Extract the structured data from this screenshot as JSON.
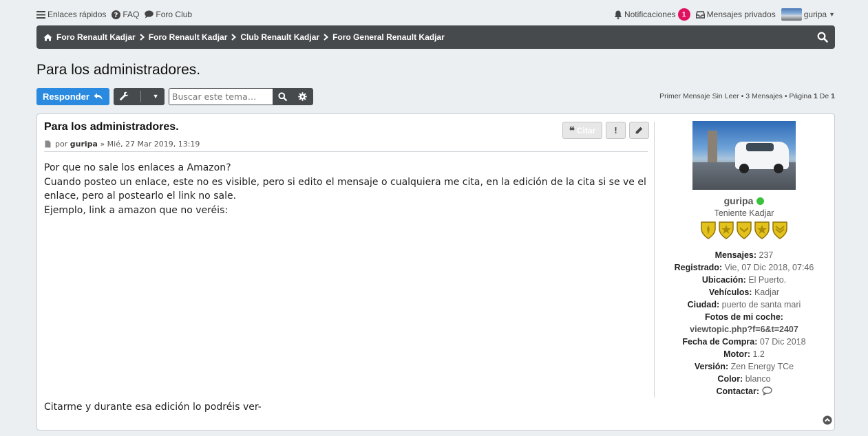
{
  "topbar": {
    "quick_links": "Enlaces rápidos",
    "faq": "FAQ",
    "club": "Foro Club",
    "notifications": "Notificaciones",
    "notifications_count": "1",
    "messages": "Mensajes privados",
    "user": "guripa"
  },
  "breadcrumbs": [
    "Foro Renault Kadjar",
    "Foro Renault Kadjar",
    "Club Renault Kadjar",
    "Foro General Renault Kadjar"
  ],
  "page_title": "Para los administradores.",
  "actions": {
    "reply": "Responder",
    "search_placeholder": "Buscar este tema…"
  },
  "pagination": {
    "first_unread": "Primer Mensaje Sin Leer",
    "count_text": "3 Mensajes",
    "page_label": "Página",
    "page_current": "1",
    "of_label": "De",
    "page_total": "1"
  },
  "post": {
    "title": "Para los administradores.",
    "by": "por",
    "author": "guripa",
    "date": "» Mié, 27 Mar 2019, 13:19",
    "quote_label": "Citar",
    "lines": [
      "Por que no sale los enlaces a Amazon?",
      "Cuando posteo un enlace, este no es visible, pero si edito el mensaje o cualquiera me cita, en la edición de la cita si se ve el enlace, pero al postearlo el link no sale.",
      "Ejemplo, link a amazon que no veréis:"
    ],
    "footer": "Citarme y durante esa edición lo podréis ver-"
  },
  "profile": {
    "username": "guripa",
    "rank": "Teniente Kadjar",
    "fields": [
      {
        "label": "Mensajes:",
        "value": "237"
      },
      {
        "label": "Registrado:",
        "value": "Vie, 07 Dic 2018, 07:46"
      },
      {
        "label": "Ubicación:",
        "value": "El Puerto."
      },
      {
        "label": "Vehículos:",
        "value": "Kadjar"
      },
      {
        "label": "Ciudad:",
        "value": "puerto de santa mari"
      }
    ],
    "photos_label": "Fotos de mi coche:",
    "photos_link": "viewtopic.php?f=6&t=2407",
    "fields2": [
      {
        "label": "Fecha de Compra:",
        "value": "07 Dic 2018"
      },
      {
        "label": "Motor:",
        "value": "1.2"
      },
      {
        "label": "Versión:",
        "value": "Zen Energy TCe"
      },
      {
        "label": "Color:",
        "value": "blanco"
      }
    ],
    "contact_label": "Contactar:"
  },
  "colors": {
    "accent": "#2a8ae0",
    "nav": "#474a4d",
    "badge": "#e0115f",
    "online": "#3bc13b"
  }
}
